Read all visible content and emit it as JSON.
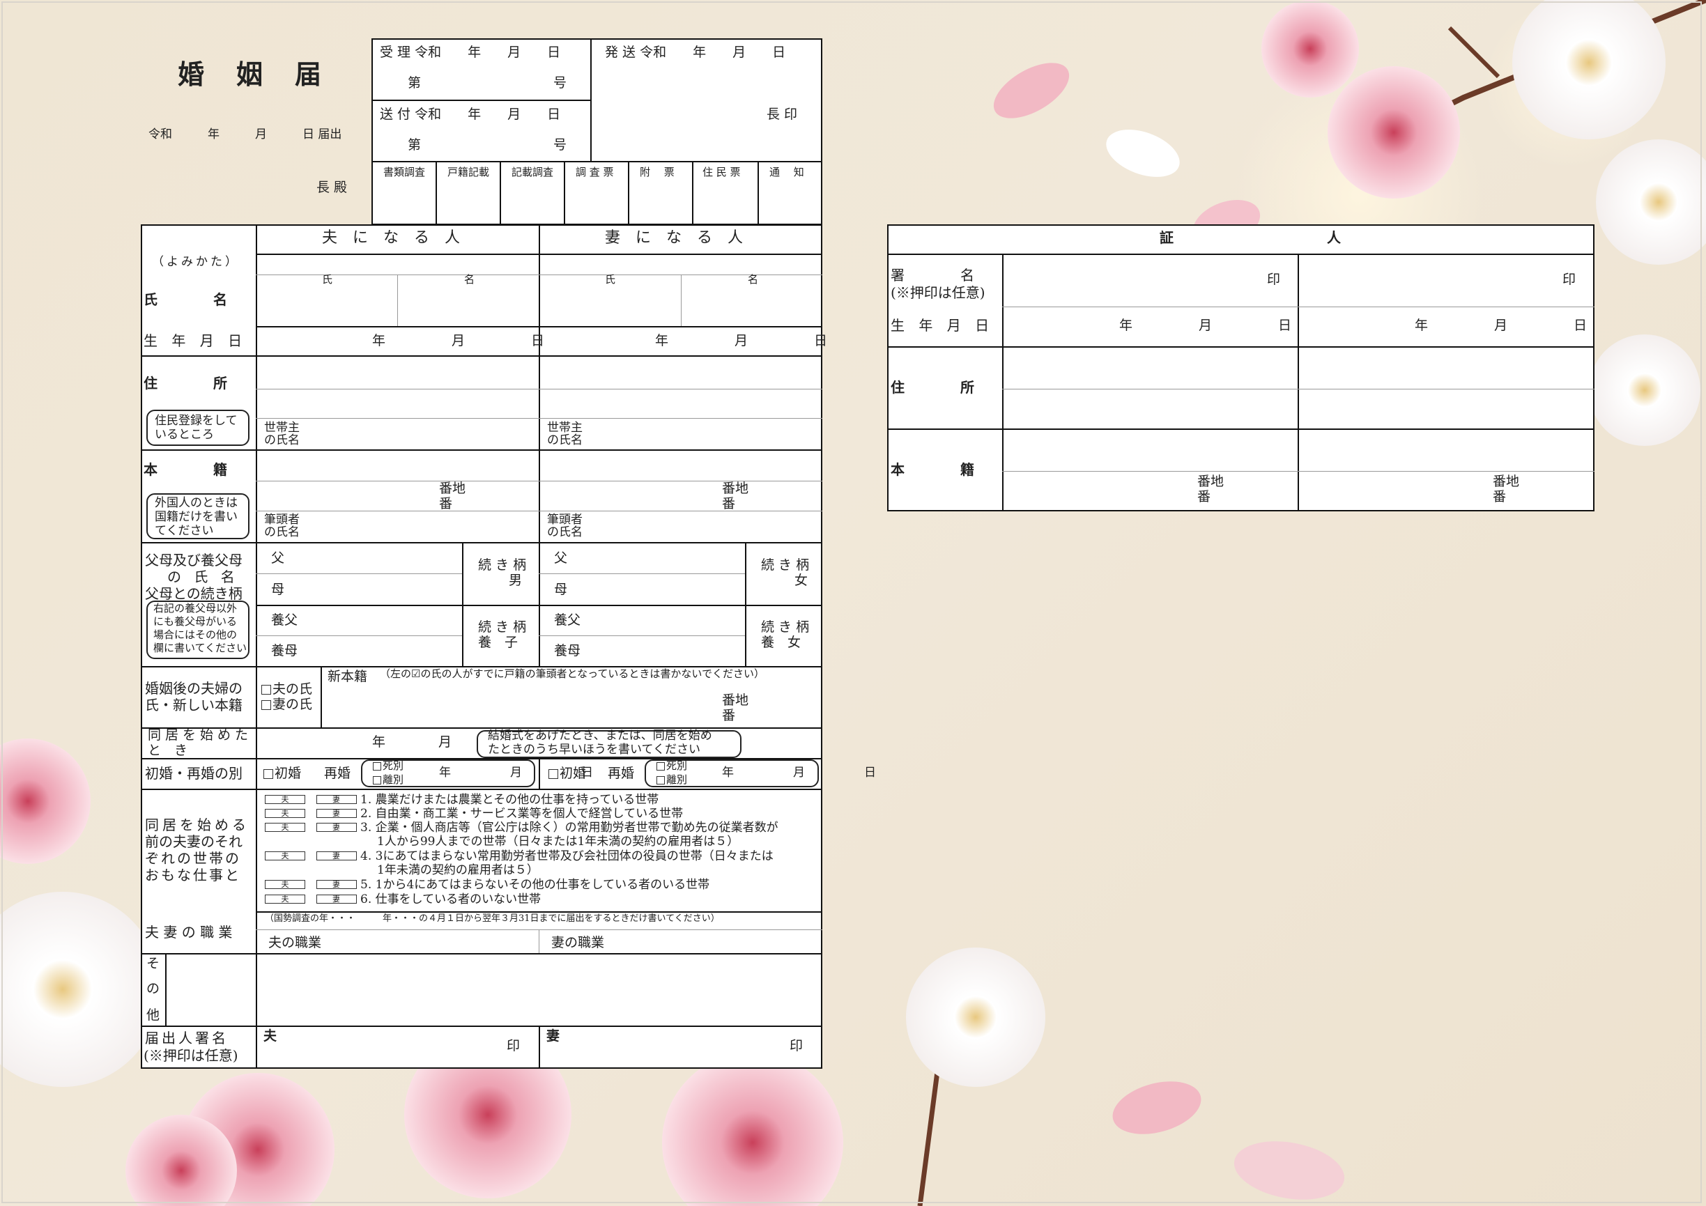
{
  "title": "婚　姻　届",
  "date_line": "令和　　　年　　　月　　　日 届出",
  "chief_line": "長 殿",
  "office": {
    "received": "受 理 令和　　年　　月　　日",
    "received_no": "第　　　　　　　　　　号",
    "sent_from": "送 付 令和　　年　　月　　日",
    "sent_no": "第　　　　　　　　　　号",
    "dispatched": "発 送 令和　　年　　月　　日",
    "chief_seal": "長 印",
    "checks": [
      "書類調査",
      "戸籍記載",
      "記載調査",
      "調 査 票",
      "附　 票",
      "住 民 票",
      "通　 知"
    ]
  },
  "husband_header": "夫　に　な　る　人",
  "wife_header": "妻　に　な　る　人",
  "reading_label": "（よみかた）",
  "name_label": "氏　　　　名",
  "surname": "氏",
  "given": "名",
  "birth_label": "生 年 月 日",
  "ymd": "年　　　　　月　　　　　日",
  "address_label": "住　　　　所",
  "address_note": [
    "住民登録をして",
    "いるところ"
  ],
  "householder": [
    "世帯主",
    "の氏名"
  ],
  "domicile_label": "本　　　　籍",
  "domicile_note": [
    "外国人のときは",
    "国籍だけを書い",
    "てください"
  ],
  "lot": [
    "番地",
    "番"
  ],
  "head_of_family": [
    "筆頭者",
    "の氏名"
  ],
  "parents_label": [
    "父母及び養父母",
    "の 氏 名",
    "父母との続き柄"
  ],
  "parents_note": [
    "右記の養父母以外",
    "にも養父母がいる",
    "場合にはその他の",
    "欄に書いてください"
  ],
  "father": "父",
  "mother": "母",
  "adoptive_father": "養父",
  "adoptive_mother": "養母",
  "relation_label": "続 き 柄",
  "husband_relation": "男",
  "wife_relation": "女",
  "adopt_husband": "養　子",
  "adopt_wife": "養　女",
  "after_label": [
    "婚姻後の夫婦の",
    "氏・新しい本籍"
  ],
  "husband_surname": "夫の氏",
  "wife_surname": "妻の氏",
  "new_domicile": "新本籍",
  "new_domicile_note": "（左の☑の氏の人がすでに戸籍の筆頭者となっているときは書かないでください）",
  "cohabit_label": [
    "同居を始めた",
    "と　き"
  ],
  "ym": "年　　　　月",
  "cohabit_note": [
    "結婚式をあげたとき、または、同居を始め",
    "たときのうち早いほうを書いてください"
  ],
  "remarriage_label": "初婚・再婚の別",
  "first_marriage": "初婚",
  "remarriage": "再婚",
  "death": "死別",
  "divorce": "離別",
  "occupation_label": [
    "同居を始める",
    "前の夫妻のそれ",
    "ぞれの世帯の",
    "おもな仕事と"
  ],
  "husband_short": "夫",
  "wife_short": "妻",
  "work_items": [
    "1. 農業だけまたは農業とその他の仕事を持っている世帯",
    "2. 自由業・商工業・サービス業等を個人で経営している世帯",
    "3. 企業・個人商店等（官公庁は除く）の常用勤労者世帯で勤め先の従業者数が",
    "1人から99人までの世帯（日々または1年未満の契約の雇用者は５）",
    "4. 3にあてはまらない常用勤労者世帯及び会社団体の役員の世帯（日々または",
    "1年未満の契約の雇用者は５）",
    "5. 1から4にあてはまらないその他の仕事をしている者のいる世帯",
    "6. 仕事をしている者のいない世帯"
  ],
  "job_label": "夫 妻 の 職 業",
  "census_note": "（国勢調査の年・・・　　　年・・・の４月１日から翌年３月31日までに届出をするときだけ書いてください）",
  "husband_job": "夫の職業",
  "wife_job": "妻の職業",
  "other_label": [
    "そ",
    "の",
    "他"
  ],
  "signature_label": [
    "届出人署名",
    "(※押印は任意)"
  ],
  "seal": "印",
  "witness": {
    "header": "証　　　　　　　　　　　人",
    "sign_label": [
      "署　　　　名",
      "(※押印は任意)"
    ],
    "birth_label": "生 年 月 日",
    "ymd": "年　　　　　月　　　　　日",
    "address_label": "住　　　　所",
    "domicile_label": "本　　　　籍"
  }
}
